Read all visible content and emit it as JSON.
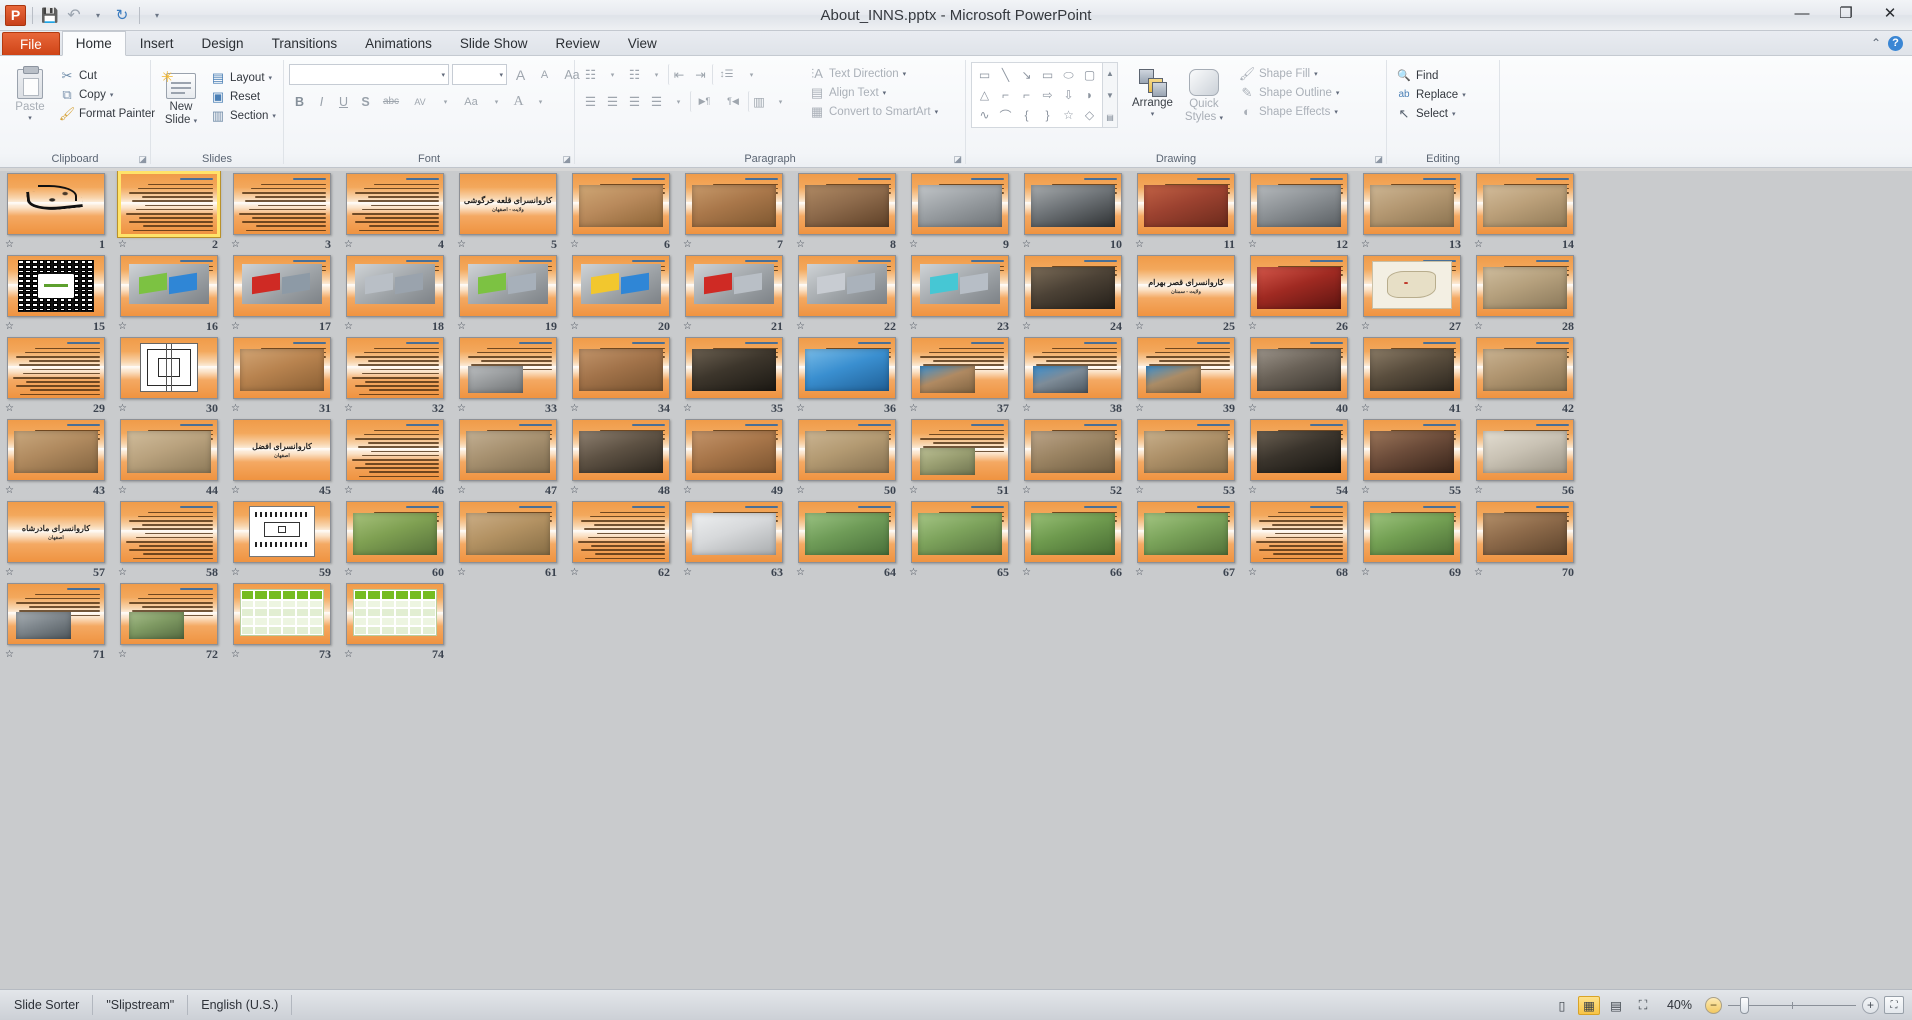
{
  "window": {
    "title": "About_INNS.pptx  -  Microsoft PowerPoint",
    "minimize": "—",
    "restore": "❐",
    "close": "✕"
  },
  "qat": {
    "logo": "P",
    "save": "💾",
    "undo": "↶",
    "redo": "↻",
    "customize": "▾",
    "undo_caret": "▾"
  },
  "tabs": [
    {
      "label": "File",
      "type": "file"
    },
    {
      "label": "Home",
      "type": "active"
    },
    {
      "label": "Insert",
      "type": "normal"
    },
    {
      "label": "Design",
      "type": "normal"
    },
    {
      "label": "Transitions",
      "type": "normal"
    },
    {
      "label": "Animations",
      "type": "normal"
    },
    {
      "label": "Slide Show",
      "type": "normal"
    },
    {
      "label": "Review",
      "type": "normal"
    },
    {
      "label": "View",
      "type": "normal"
    }
  ],
  "tab_right": {
    "minimize_ribbon": "⌃",
    "help": "?"
  },
  "ribbon": {
    "groups": [
      {
        "label": "Clipboard",
        "dialog_launcher": "◪"
      },
      {
        "label": "Slides",
        "dialog_launcher": ""
      },
      {
        "label": "Font",
        "dialog_launcher": "◪"
      },
      {
        "label": "Paragraph",
        "dialog_launcher": "◪"
      },
      {
        "label": "Drawing",
        "dialog_launcher": "◪"
      },
      {
        "label": "Editing",
        "dialog_launcher": ""
      }
    ],
    "clipboard": {
      "paste": "Paste",
      "paste_caret": "▾",
      "cut": "Cut",
      "copy": "Copy",
      "copy_caret": "▾",
      "format_painter": "Format Painter",
      "cut_icon": "✂",
      "copy_icon": "⧉",
      "painter_icon": "🖌"
    },
    "slides": {
      "new_slide_line1": "New",
      "new_slide_line2": "Slide",
      "new_slide_caret": "▾",
      "layout": "Layout",
      "reset": "Reset",
      "section": "Section",
      "layout_caret": "▾",
      "section_caret": "▾"
    },
    "font": {
      "font_name": "",
      "font_size": "",
      "font_name_caret": "▾",
      "font_size_caret": "▾",
      "grow": "A",
      "shrink": "A",
      "clear_format": "Aa",
      "bold": "B",
      "italic": "I",
      "underline": "U",
      "shadow": "S",
      "strikethrough": "abc",
      "spacing": "AV",
      "change_case": "Aa",
      "font_color": "A"
    },
    "paragraph": {
      "bullets": "☷",
      "numbering": "☷",
      "decrease_indent": "⇤",
      "increase_indent": "⇥",
      "line_spacing": "↕☰",
      "align_left": "☰",
      "align_center": "☰",
      "align_right": "☰",
      "justify": "☰",
      "ltr": "▶¶",
      "rtl": "¶◀",
      "columns": "▥",
      "text_direction": "Text Direction",
      "align_text": "Align Text",
      "convert_smartart": "Convert to SmartArt",
      "caret": "▾"
    },
    "drawing": {
      "shapes": [
        "▭",
        "╲",
        "↘",
        "▭",
        "⬭",
        "▢",
        "△",
        "⌐",
        "⌐",
        "⇨",
        "⇩",
        "◗",
        "∿",
        "⌒",
        "{",
        "}",
        "☆",
        "◇"
      ],
      "arrange": "Arrange",
      "arrange_caret": "▾",
      "quick_styles_line1": "Quick",
      "quick_styles_line2": "Styles",
      "quick_caret": "▾",
      "shape_fill": "Shape Fill",
      "shape_outline": "Shape Outline",
      "shape_effects": "Shape Effects",
      "caret": "▾"
    },
    "editing": {
      "find": "Find",
      "replace": "Replace",
      "select": "Select",
      "find_icon": "🔍",
      "replace_icon": "ab",
      "select_icon": "↖",
      "caret": "▾"
    }
  },
  "sorter": {
    "columns": 14,
    "selected_slide": 2,
    "animation_icon": "☆",
    "slides": [
      {
        "n": 1,
        "kind": "calligraphy"
      },
      {
        "n": 2,
        "kind": "text",
        "lines": 14
      },
      {
        "n": 3,
        "kind": "text",
        "lines": 14
      },
      {
        "n": 4,
        "kind": "text",
        "lines": 14
      },
      {
        "n": 5,
        "kind": "title",
        "title": "کاروانسرای قلعه خرگوشی",
        "subtitle": "ولایت - اصفهان"
      },
      {
        "n": 6,
        "kind": "photo",
        "photo": "fort-brick"
      },
      {
        "n": 7,
        "kind": "photo",
        "photo": "arch-brick"
      },
      {
        "n": 8,
        "kind": "photo",
        "photo": "dome-interior"
      },
      {
        "n": 9,
        "kind": "photo",
        "photo": "bw-desert"
      },
      {
        "n": 10,
        "kind": "photo",
        "photo": "bw-stripes"
      },
      {
        "n": 11,
        "kind": "photo",
        "photo": "red-wall"
      },
      {
        "n": 12,
        "kind": "photo",
        "photo": "bw-arches"
      },
      {
        "n": 13,
        "kind": "photo",
        "photo": "desert-ruin"
      },
      {
        "n": 14,
        "kind": "photo",
        "photo": "desert-ruin2"
      },
      {
        "n": 15,
        "kind": "plan",
        "plan": "grid-plan-white"
      },
      {
        "n": 16,
        "kind": "model",
        "colors": [
          "#7cc242",
          "#2f86d6"
        ]
      },
      {
        "n": 17,
        "kind": "model",
        "colors": [
          "#cf2a24",
          "#8d9aa6"
        ]
      },
      {
        "n": 18,
        "kind": "model",
        "colors": [
          "#b9bfc6",
          "#9aa3ad"
        ]
      },
      {
        "n": 19,
        "kind": "model",
        "colors": [
          "#7cc242",
          "#a7b0ba"
        ]
      },
      {
        "n": 20,
        "kind": "model",
        "colors": [
          "#f2c72e",
          "#2f86d6"
        ]
      },
      {
        "n": 21,
        "kind": "model",
        "colors": [
          "#cf2a24",
          "#b9bfc6"
        ]
      },
      {
        "n": 22,
        "kind": "model",
        "colors": [
          "#c8ccd2",
          "#aab2bb"
        ]
      },
      {
        "n": 23,
        "kind": "model",
        "colors": [
          "#46c7d4",
          "#b7bec6"
        ]
      },
      {
        "n": 24,
        "kind": "photo",
        "photo": "vault-dark"
      },
      {
        "n": 25,
        "kind": "title",
        "title": "کاروانسرای قصر بهرام",
        "subtitle": "ولایت - سمنان"
      },
      {
        "n": 26,
        "kind": "photo",
        "photo": "red-interior"
      },
      {
        "n": 27,
        "kind": "map"
      },
      {
        "n": 28,
        "kind": "photo",
        "photo": "desert-fort"
      },
      {
        "n": 29,
        "kind": "text",
        "lines": 14
      },
      {
        "n": 30,
        "kind": "plan",
        "plan": "line-plan"
      },
      {
        "n": 31,
        "kind": "photo",
        "photo": "courtyard-brick"
      },
      {
        "n": 32,
        "kind": "text",
        "lines": 13
      },
      {
        "n": 33,
        "kind": "textphoto",
        "photo": "aerial-grey"
      },
      {
        "n": 34,
        "kind": "photo",
        "photo": "arch-row"
      },
      {
        "n": 35,
        "kind": "photo",
        "photo": "dark-vault"
      },
      {
        "n": 36,
        "kind": "photo",
        "photo": "blue-globe"
      },
      {
        "n": 37,
        "kind": "textphoto",
        "photo": "globe-arch"
      },
      {
        "n": 38,
        "kind": "textphoto",
        "photo": "globe-vault"
      },
      {
        "n": 39,
        "kind": "textphoto",
        "photo": "globe-court"
      },
      {
        "n": 40,
        "kind": "photo",
        "photo": "stone-dark"
      },
      {
        "n": 41,
        "kind": "photo",
        "photo": "vault-pair"
      },
      {
        "n": 42,
        "kind": "photo",
        "photo": "ruin-wide"
      },
      {
        "n": 43,
        "kind": "photo",
        "photo": "brick-facade"
      },
      {
        "n": 44,
        "kind": "photo",
        "photo": "desert-ruins"
      },
      {
        "n": 45,
        "kind": "title",
        "title": "کاروانسرای افضل",
        "subtitle": "اصفهان"
      },
      {
        "n": 46,
        "kind": "text",
        "lines": 13
      },
      {
        "n": 47,
        "kind": "photo",
        "photo": "courtyard-stone"
      },
      {
        "n": 48,
        "kind": "photo",
        "photo": "corridor-dark"
      },
      {
        "n": 49,
        "kind": "photo",
        "photo": "brick-arches"
      },
      {
        "n": 50,
        "kind": "photo",
        "photo": "courtyard-arcade"
      },
      {
        "n": 51,
        "kind": "textphoto",
        "photo": "courtyard-green"
      },
      {
        "n": 52,
        "kind": "photo",
        "photo": "column-hall"
      },
      {
        "n": 53,
        "kind": "photo",
        "photo": "arcade-arch"
      },
      {
        "n": 54,
        "kind": "photo",
        "photo": "dark-room"
      },
      {
        "n": 55,
        "kind": "photo",
        "photo": "carpet-room"
      },
      {
        "n": 56,
        "kind": "photo",
        "photo": "white-vault"
      },
      {
        "n": 57,
        "kind": "title",
        "title": "کاروانسرای مادرشاه",
        "subtitle": "اصفهان"
      },
      {
        "n": 58,
        "kind": "text",
        "lines": 13
      },
      {
        "n": 59,
        "kind": "plan",
        "plan": "tech-plan"
      },
      {
        "n": 60,
        "kind": "photo",
        "photo": "garden-court"
      },
      {
        "n": 61,
        "kind": "photo",
        "photo": "arch-pair"
      },
      {
        "n": 62,
        "kind": "text",
        "lines": 14
      },
      {
        "n": 63,
        "kind": "photo",
        "photo": "hotel-white"
      },
      {
        "n": 64,
        "kind": "photo",
        "photo": "garden-pool"
      },
      {
        "n": 65,
        "kind": "photo",
        "photo": "garden-path"
      },
      {
        "n": 66,
        "kind": "photo",
        "photo": "green-court"
      },
      {
        "n": 67,
        "kind": "photo",
        "photo": "garden-wide"
      },
      {
        "n": 68,
        "kind": "text",
        "lines": 14
      },
      {
        "n": 69,
        "kind": "photo",
        "photo": "garden-aerial"
      },
      {
        "n": 70,
        "kind": "photo",
        "photo": "restaurant"
      },
      {
        "n": 71,
        "kind": "textphoto",
        "photo": "parking-lot"
      },
      {
        "n": 72,
        "kind": "textphoto",
        "photo": "hotel-garden"
      },
      {
        "n": 73,
        "kind": "table",
        "cols": 6,
        "rows": 4
      },
      {
        "n": 74,
        "kind": "table",
        "cols": 6,
        "rows": 4
      }
    ]
  },
  "statusbar": {
    "view_name": "Slide Sorter",
    "theme": "\"Slipstream\"",
    "language": "English (U.S.)",
    "zoom_percent": "40%",
    "zoom_out": "−",
    "zoom_in": "+",
    "fit_window": "⛶",
    "views": [
      {
        "name": "normal",
        "glyph": "▯",
        "active": false
      },
      {
        "name": "slide-sorter",
        "glyph": "▦",
        "active": true
      },
      {
        "name": "reading",
        "glyph": "▤",
        "active": false
      },
      {
        "name": "slideshow",
        "glyph": "⛶",
        "active": false
      }
    ]
  }
}
